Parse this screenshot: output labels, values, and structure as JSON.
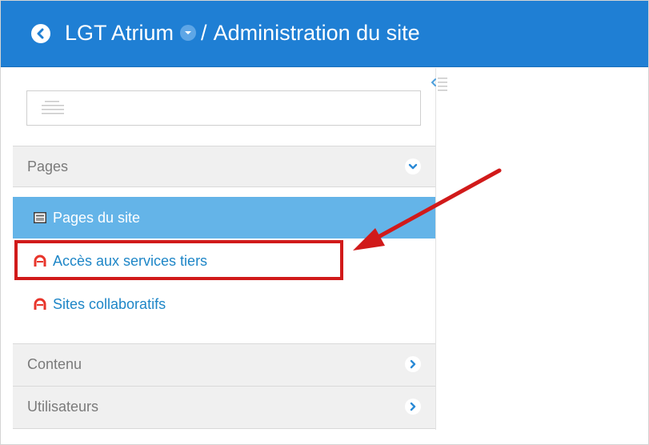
{
  "header": {
    "site_name": "LGT Atrium",
    "separator": "/",
    "page_title": "Administration du site",
    "background_color": "#1f7fd4"
  },
  "sidebar": {
    "search": {
      "value": "",
      "placeholder": ""
    },
    "sections": [
      {
        "label": "Pages",
        "expanded": true,
        "chevron_icon": "chevron-down-icon",
        "items": [
          {
            "label": "Pages du site",
            "icon": "page-icon",
            "active": true
          },
          {
            "label": "Accès aux services tiers",
            "icon": "portlet-icon",
            "active": false
          },
          {
            "label": "Sites collaboratifs",
            "icon": "portlet-icon",
            "active": false
          }
        ]
      },
      {
        "label": "Contenu",
        "expanded": false,
        "chevron_icon": "chevron-right-icon"
      },
      {
        "label": "Utilisateurs",
        "expanded": false,
        "chevron_icon": "chevron-right-icon"
      }
    ]
  },
  "colors": {
    "accent": "#1f7fd4",
    "active_item": "#64b4e8",
    "link": "#1e86c7",
    "annotation": "#d11a1a"
  }
}
